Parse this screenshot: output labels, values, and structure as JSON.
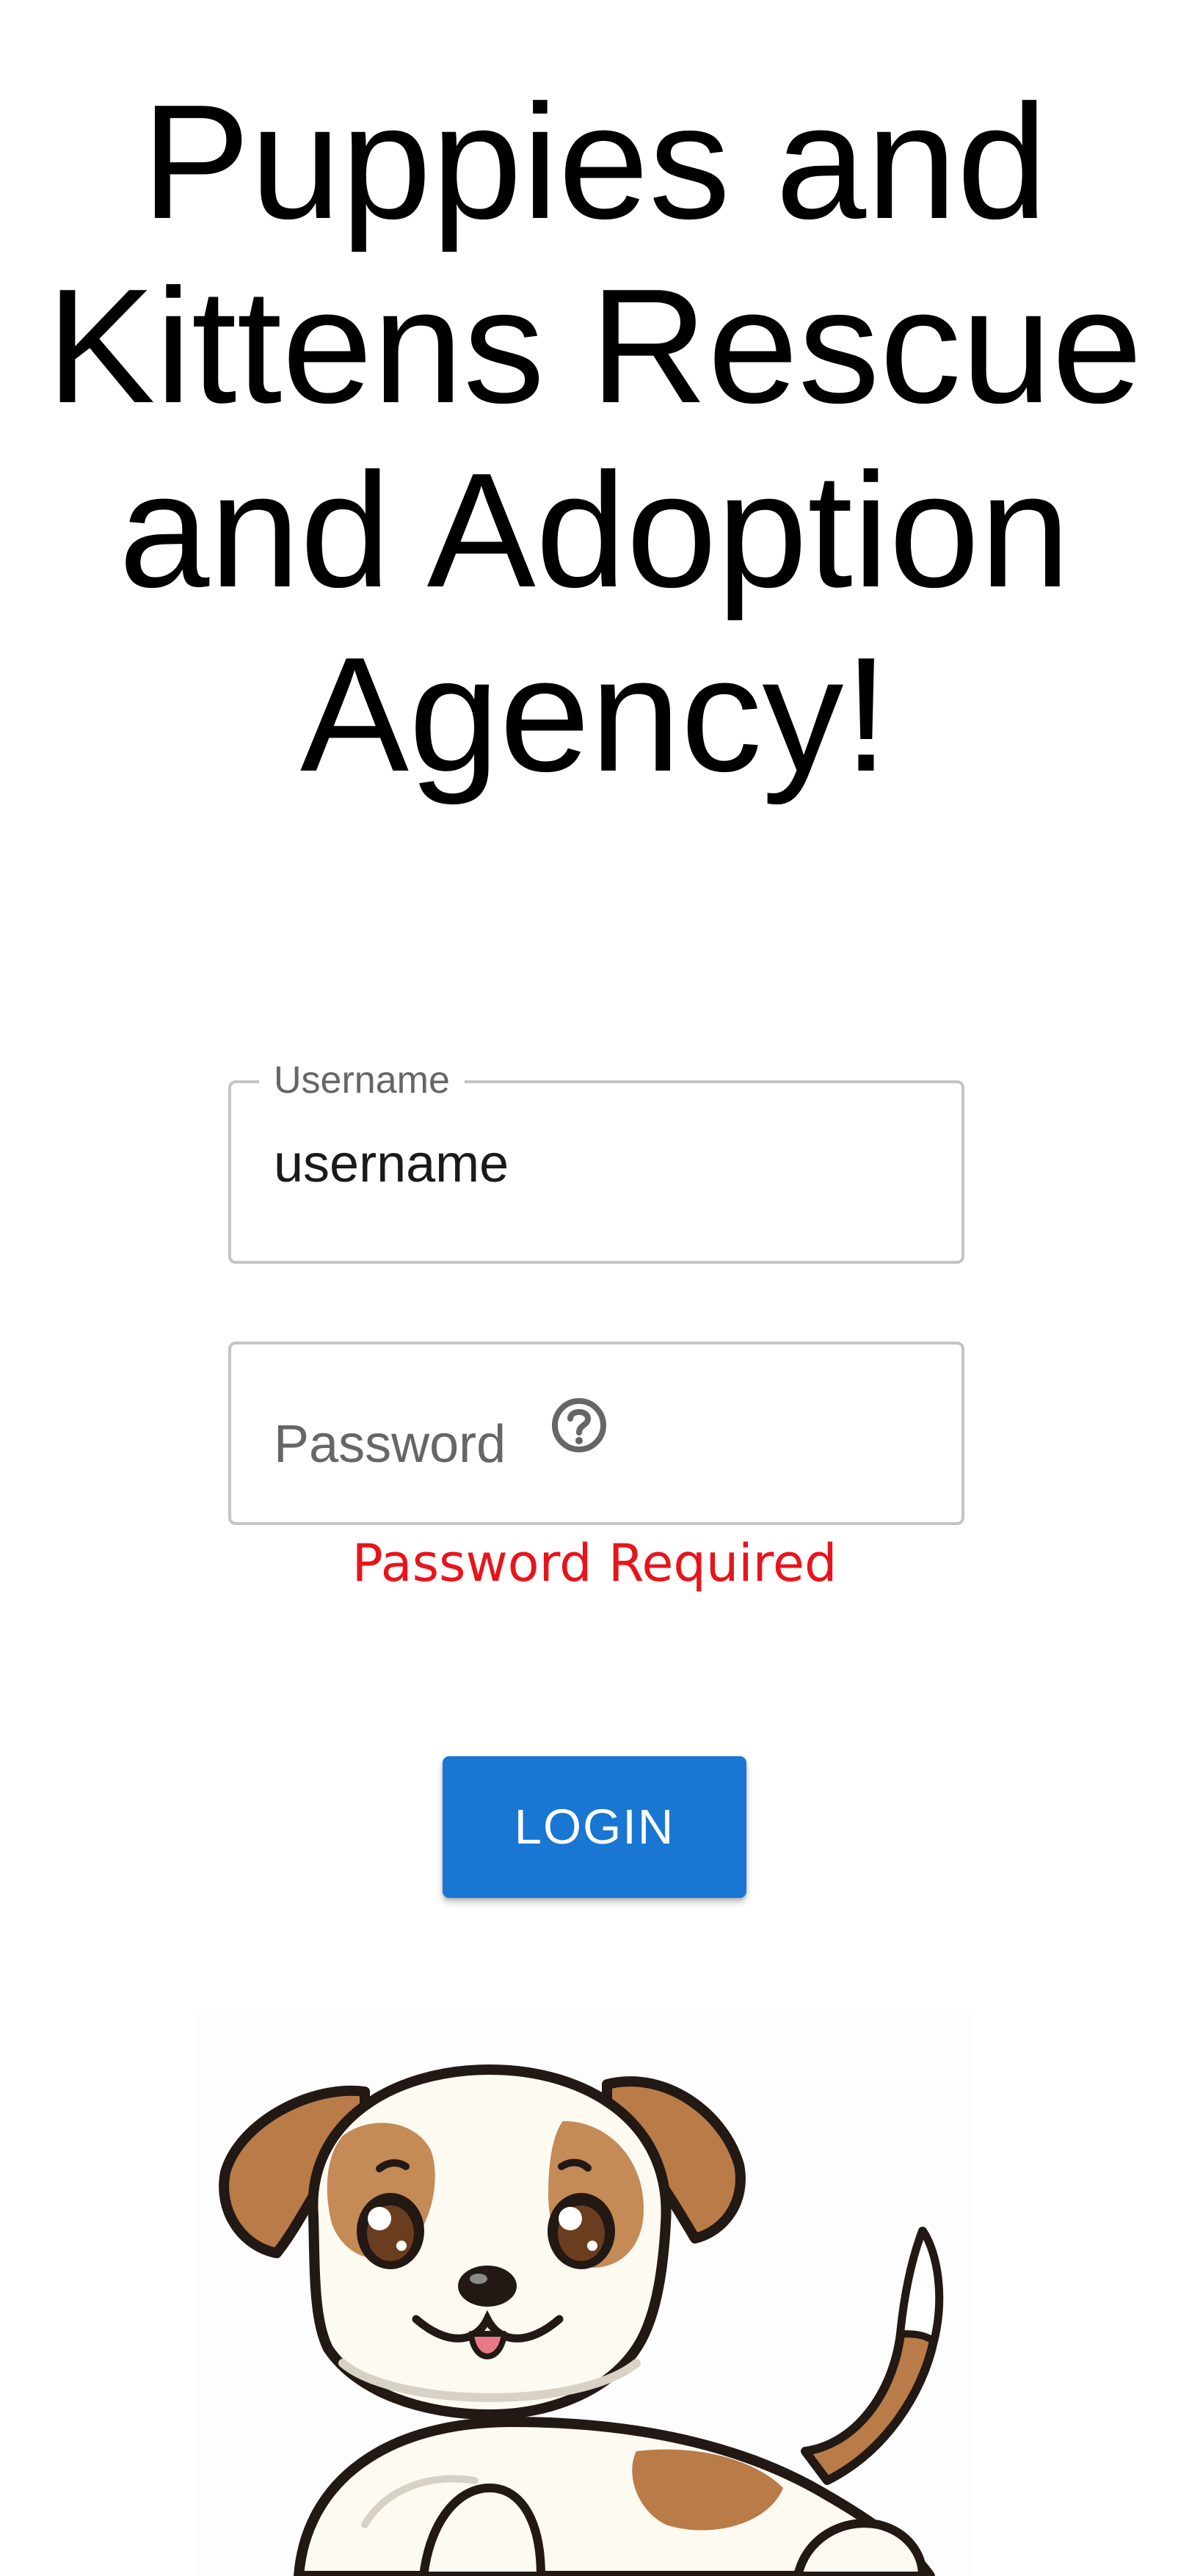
{
  "header": {
    "title": "Puppies and Kittens Rescue and Adoption Agency!"
  },
  "login_form": {
    "username": {
      "label": "Username",
      "value": "username"
    },
    "password": {
      "placeholder": "Password",
      "help_icon": "question-circle-icon",
      "error": "Password Required"
    },
    "submit_label": "LOGIN"
  },
  "mascot": {
    "icon": "cartoon-puppy"
  },
  "colors": {
    "accent": "#1976d2",
    "error": "#e8141b",
    "border": "#c4c4c4",
    "puppy_brown": "#b97b47",
    "puppy_cream": "#fdfaf1"
  }
}
